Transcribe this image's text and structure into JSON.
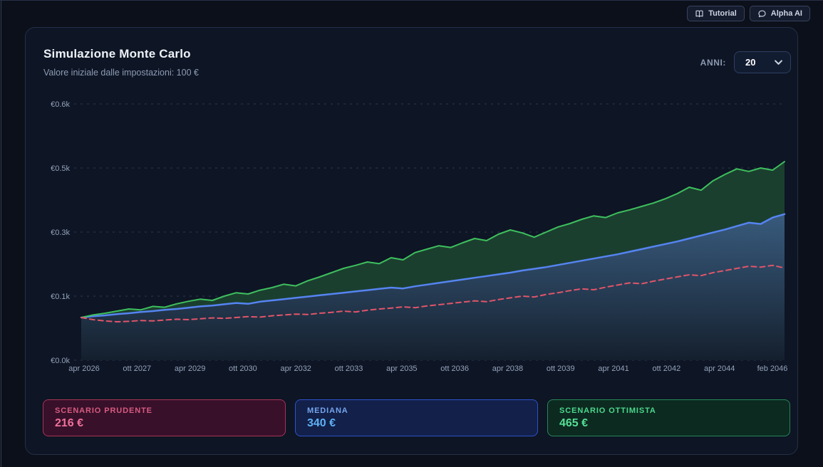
{
  "topbar": {
    "tutorial_label": "Tutorial",
    "alpha_ai_label": "Alpha AI"
  },
  "icons": {
    "tutorial": "open-book",
    "alpha_ai": "speech-bubble",
    "years_select": "chevron-down"
  },
  "panel": {
    "title": "Simulazione Monte Carlo",
    "subtitle": "Valore iniziale dalle impostazioni: 100 €",
    "years_label": "ANNI:",
    "years_value": "20"
  },
  "chart_data": {
    "type": "line",
    "title": "Simulazione Monte Carlo",
    "currency": "EUR",
    "ylim": [
      0,
      625
    ],
    "grid": true,
    "y_ticks": [
      {
        "label": "€0.6k",
        "value": 600
      },
      {
        "label": "€0.5k",
        "value": 450
      },
      {
        "label": "€0.3k",
        "value": 300
      },
      {
        "label": "€0.1k",
        "value": 150
      },
      {
        "label": "€0.0k",
        "value": 0
      }
    ],
    "x_tick_labels": [
      "apr 2026",
      "ott 2027",
      "apr 2029",
      "ott 2030",
      "apr 2032",
      "ott 2033",
      "apr 2035",
      "ott 2036",
      "apr 2038",
      "ott 2039",
      "apr 2041",
      "ott 2042",
      "apr 2044",
      "feb 2046"
    ],
    "fill_colors": {
      "between": "#1c4130",
      "under_top": "#3d6286",
      "under_bottom": "#15202e"
    },
    "grid_color": "#39455f",
    "series": [
      {
        "name": "Scenario Ottimista",
        "color": "#3ec05e",
        "line_style": "solid",
        "fill": "between_median",
        "final_value": 465,
        "values": [
          100,
          106,
          110,
          115,
          120,
          118,
          126,
          124,
          132,
          138,
          143,
          140,
          150,
          158,
          155,
          164,
          170,
          178,
          174,
          186,
          195,
          205,
          215,
          222,
          230,
          226,
          240,
          235,
          252,
          260,
          268,
          264,
          275,
          285,
          280,
          295,
          305,
          298,
          288,
          300,
          312,
          320,
          330,
          338,
          334,
          345,
          352,
          360,
          368,
          378,
          390,
          405,
          398,
          420,
          435,
          448,
          442,
          450,
          445,
          465
        ]
      },
      {
        "name": "Mediana",
        "color": "#5584f2",
        "line_style": "solid",
        "fill": "under_gradient",
        "final_value": 340,
        "values": [
          100,
          103,
          105,
          108,
          110,
          113,
          115,
          118,
          120,
          123,
          126,
          128,
          131,
          134,
          132,
          137,
          140,
          143,
          146,
          149,
          152,
          155,
          158,
          161,
          164,
          167,
          170,
          168,
          173,
          177,
          181,
          185,
          189,
          193,
          197,
          201,
          205,
          210,
          214,
          218,
          223,
          228,
          233,
          238,
          243,
          248,
          254,
          260,
          266,
          272,
          278,
          285,
          292,
          299,
          306,
          314,
          322,
          319,
          334,
          342
        ]
      },
      {
        "name": "Scenario Prudente",
        "color": "#e0556a",
        "line_style": "dashed",
        "fill": "none",
        "final_value": 216,
        "values": [
          100,
          95,
          92,
          90,
          91,
          93,
          92,
          94,
          96,
          95,
          97,
          99,
          98,
          100,
          102,
          101,
          104,
          106,
          108,
          107,
          110,
          112,
          115,
          113,
          117,
          120,
          122,
          125,
          123,
          127,
          130,
          133,
          136,
          139,
          137,
          142,
          146,
          150,
          148,
          154,
          158,
          163,
          167,
          165,
          171,
          176,
          181,
          179,
          185,
          190,
          195,
          200,
          198,
          205,
          210,
          215,
          220,
          218,
          222,
          216
        ]
      }
    ]
  },
  "summary_cards": [
    {
      "label": "SCENARIO PRUDENTE",
      "value": "216 €",
      "bg": "#38102a",
      "border": "#a83455",
      "label_color": "#d75b80",
      "value_color": "#f0719a"
    },
    {
      "label": "MEDIANA",
      "value": "340 €",
      "bg": "#12204a",
      "border": "#2d53cd",
      "label_color": "#76a5ec",
      "value_color": "#5eb1f5"
    },
    {
      "label": "SCENARIO OTTIMISTA",
      "value": "465 €",
      "bg": "#0c2a20",
      "border": "#27865a",
      "label_color": "#4cd78c",
      "value_color": "#55e095"
    }
  ]
}
